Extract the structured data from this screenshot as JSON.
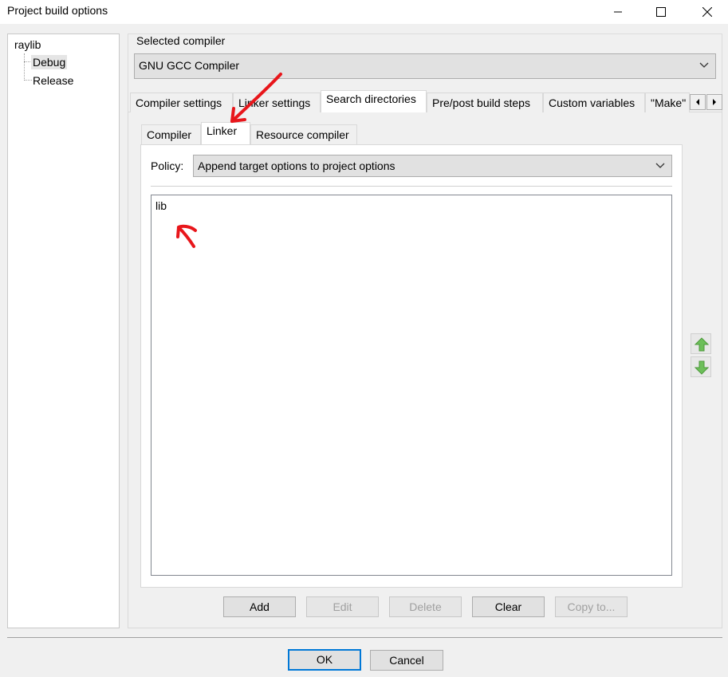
{
  "window": {
    "title": "Project build options"
  },
  "tree": {
    "root": "raylib",
    "items": [
      {
        "label": "Debug",
        "selected": true
      },
      {
        "label": "Release",
        "selected": false
      }
    ]
  },
  "compiler": {
    "group_label": "Selected compiler",
    "selected": "GNU GCC Compiler"
  },
  "main_tabs": [
    {
      "label": "Compiler settings",
      "active": false
    },
    {
      "label": "Linker settings",
      "active": false
    },
    {
      "label": "Search directories",
      "active": true
    },
    {
      "label": "Pre/post build steps",
      "active": false
    },
    {
      "label": "Custom variables",
      "active": false
    },
    {
      "label": "\"Make\"",
      "active": false
    }
  ],
  "sub_tabs": [
    {
      "label": "Compiler",
      "active": false
    },
    {
      "label": "Linker",
      "active": true
    },
    {
      "label": "Resource compiler",
      "active": false
    }
  ],
  "policy": {
    "label": "Policy:",
    "selected": "Append target options to project options"
  },
  "directories": [
    "lib"
  ],
  "list_buttons": {
    "add": "Add",
    "edit": "Edit",
    "delete": "Delete",
    "clear": "Clear",
    "copy": "Copy to..."
  },
  "dialog_buttons": {
    "ok": "OK",
    "cancel": "Cancel"
  },
  "colors": {
    "annotation": "#e8161b",
    "focus": "#0078d7",
    "move_arrow": "#6dbf5a"
  }
}
